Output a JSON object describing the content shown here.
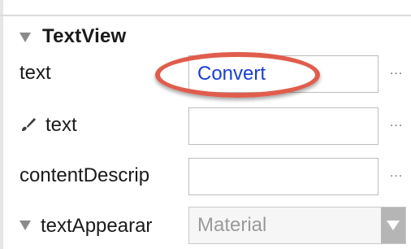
{
  "section": {
    "title": "TextView"
  },
  "properties": {
    "text": {
      "label": "text",
      "value": "Convert",
      "value_color": "#1a3fd1",
      "more": "..."
    },
    "tools_text": {
      "label": "text",
      "value": "",
      "more": "..."
    },
    "content_description": {
      "label": "contentDescrip",
      "value": "",
      "more": "..."
    },
    "text_appearance": {
      "label": "textAppearar",
      "selected": "Material"
    }
  },
  "annotation": {
    "highlight_color": "#e05d4d"
  },
  "icons": {
    "section_toggle": "triangle-down-icon",
    "tools_attribute": "brush-icon",
    "dropdown": "chevron-down-icon"
  }
}
